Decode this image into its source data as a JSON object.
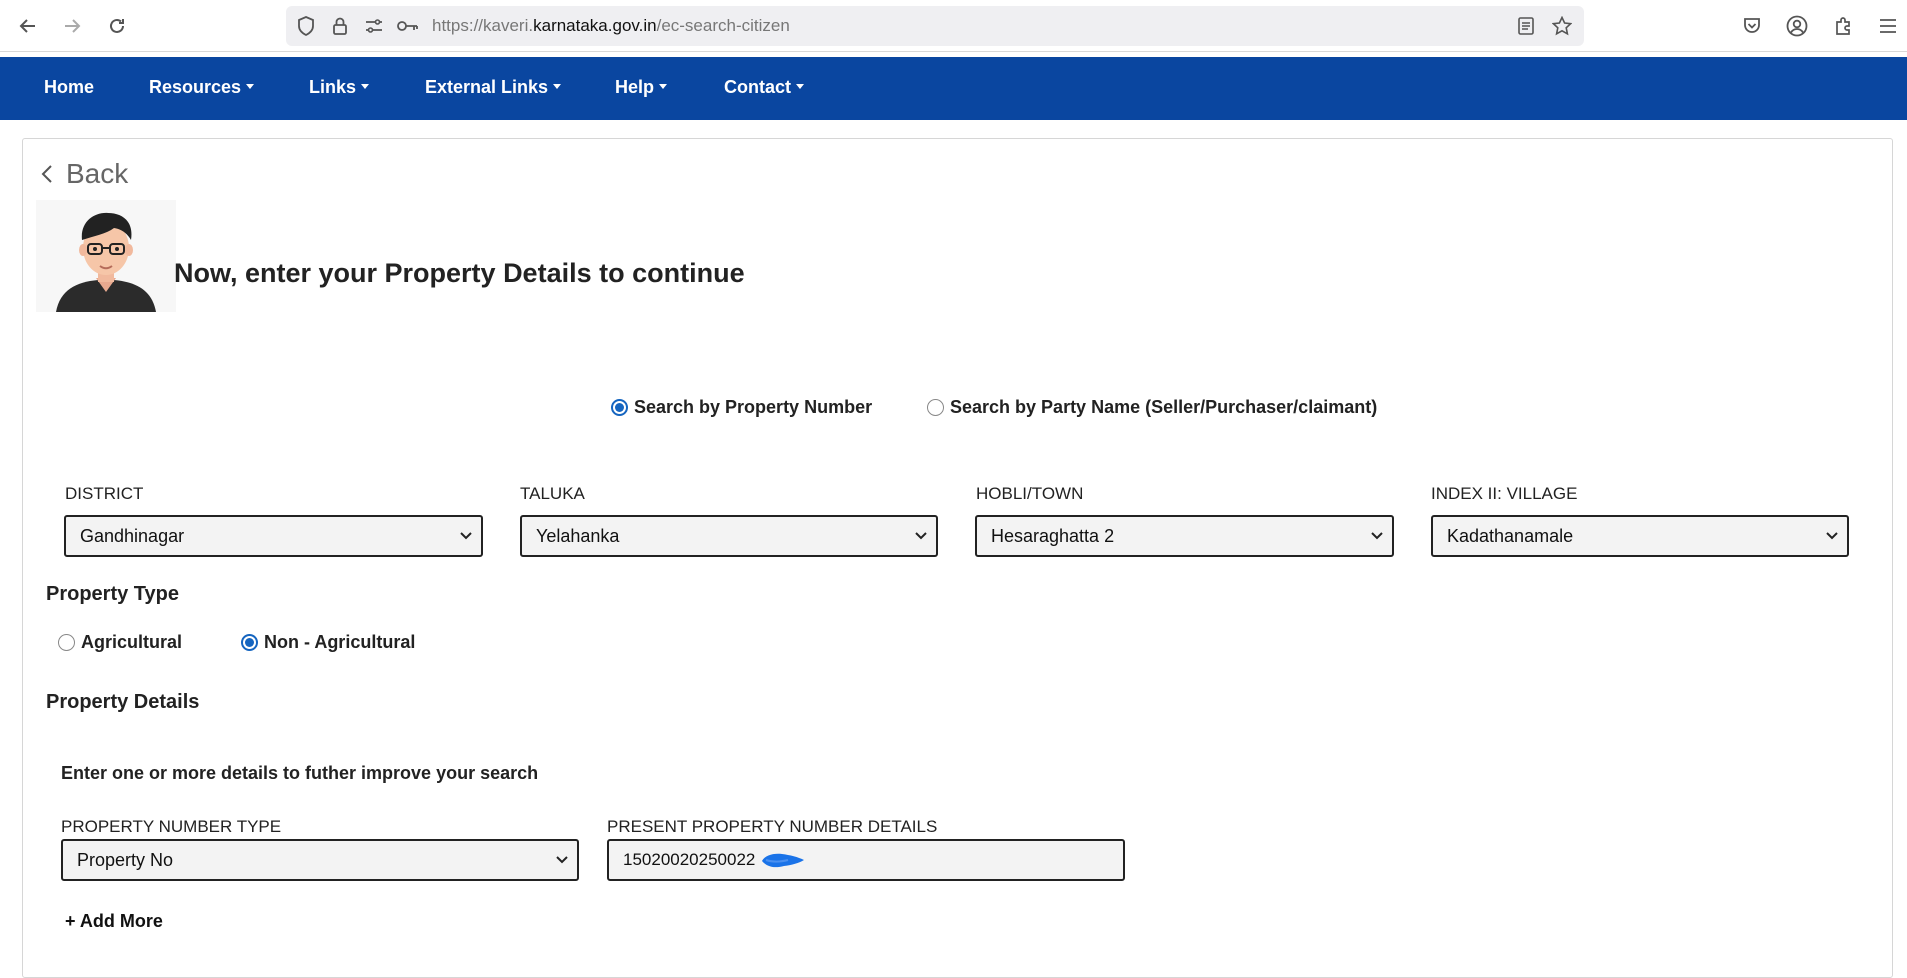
{
  "browser": {
    "url_prefix": "https://kaveri.",
    "url_host": "karnataka.gov.in",
    "url_path": "/ec-search-citizen"
  },
  "nav": {
    "home": "Home",
    "resources": "Resources",
    "links": "Links",
    "external_links": "External Links",
    "help": "Help",
    "contact": "Contact"
  },
  "page": {
    "back_label": "Back",
    "heading": "Now, enter your Property Details to continue"
  },
  "search_mode": {
    "by_property": "Search by Property Number",
    "by_party": "Search by Party Name (Seller/Purchaser/claimant)",
    "selected": "by_property"
  },
  "location": {
    "district_label": "DISTRICT",
    "district_value": "Gandhinagar",
    "taluka_label": "TALUKA",
    "taluka_value": "Yelahanka",
    "hobli_label": "HOBLI/TOWN",
    "hobli_value": "Hesaraghatta 2",
    "village_label": "INDEX II: VILLAGE",
    "village_value": "Kadathanamale"
  },
  "property_type": {
    "title": "Property Type",
    "agricultural": "Agricultural",
    "non_agricultural": "Non - Agricultural",
    "selected": "non_agricultural"
  },
  "property_details": {
    "title": "Property Details",
    "hint": "Enter one or more details to futher improve your search",
    "number_type_label": "PROPERTY NUMBER TYPE",
    "number_type_value": "Property No",
    "present_number_label": "PRESENT PROPERTY NUMBER DETAILS",
    "present_number_value": "15020020250022",
    "add_more": "+ Add More"
  },
  "colors": {
    "nav_bg": "#0a46a0",
    "radio_accent": "#1565c0",
    "redaction": "#1a73e8"
  }
}
